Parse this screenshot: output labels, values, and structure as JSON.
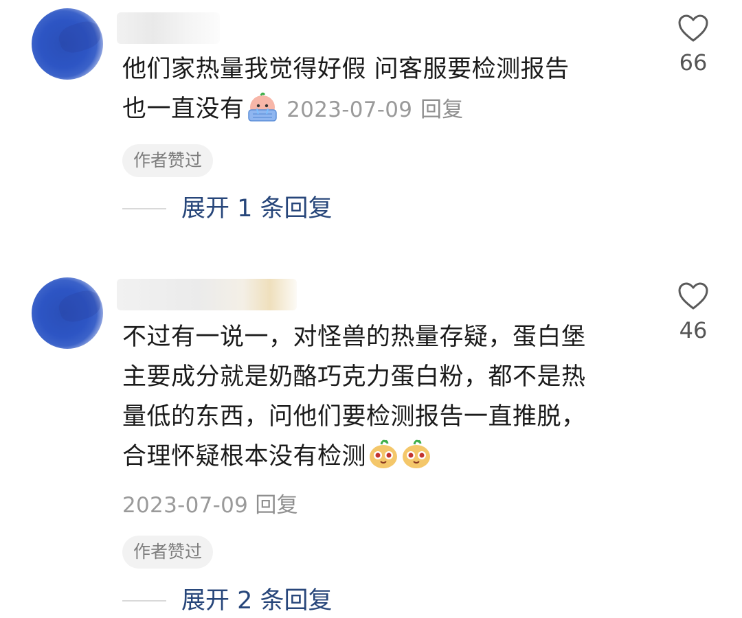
{
  "comments": [
    {
      "text_line1": "他们家热量我觉得好假 问客服要检测报告",
      "text_line2": "也一直没有",
      "emoji": [
        "crying-face-emoji"
      ],
      "date": "2023-07-09",
      "reply_label": "回复",
      "badge": "作者赞过",
      "expand_label": "展开 1 条回复",
      "like_count": "66"
    },
    {
      "text_lines": [
        "不过有一说一，对怪兽的热量存疑，蛋白堡",
        "主要成分就是奶酪巧克力蛋白粉，都不是热",
        "量低的东西，问他们要检测报告一直推脱，",
        "合理怀疑根本没有检测"
      ],
      "emoji": [
        "potato-face-emoji",
        "potato-face-emoji"
      ],
      "date": "2023-07-09",
      "reply_label": "回复",
      "badge": "作者赞过",
      "expand_label": "展开 2 条回复",
      "like_count": "46"
    }
  ],
  "colors": {
    "text": "#1b1b1b",
    "meta": "#9a9a9a",
    "expand": "#27467a",
    "badge_bg": "#f2f2f2",
    "avatar": "#2d55c4"
  }
}
